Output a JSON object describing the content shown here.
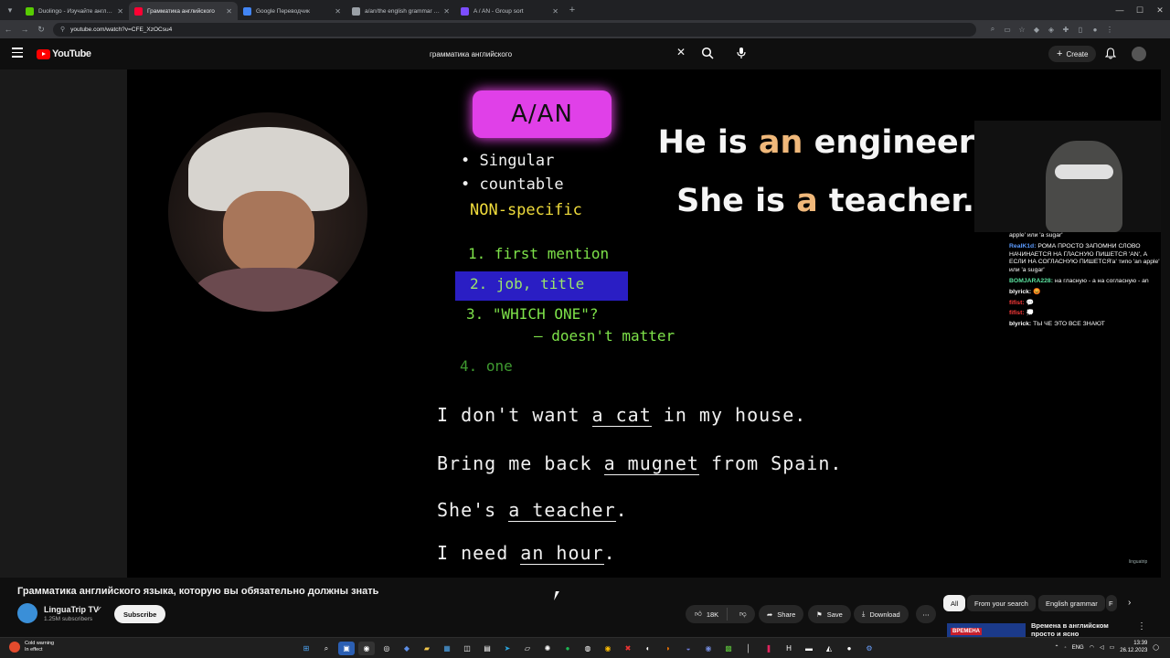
{
  "browser": {
    "tabs": [
      {
        "title": "Duolingo - Изучайте английск",
        "favicon_color": "#58cc02",
        "active": false
      },
      {
        "title": "Грамматика английского",
        "favicon_color": "#ff0033",
        "active": true
      },
      {
        "title": "Google Переводчик",
        "favicon_color": "#4285f4",
        "active": false
      },
      {
        "title": "a/an/the english grammar gam",
        "favicon_color": "#9aa0a6",
        "active": false
      },
      {
        "title": "A / AN - Group sort",
        "favicon_color": "#7c4dff",
        "active": false
      }
    ],
    "url": "youtube.com/watch?v=CFE_XzOCsu4"
  },
  "masthead": {
    "logo_text": "YouTube",
    "search_value": "грамматика английского",
    "create_label": "Create"
  },
  "slide": {
    "title": "A/AN",
    "bullets": [
      "Singular",
      "countable"
    ],
    "nonspecific": "NON-specific",
    "rules": [
      {
        "text": "1. first mention"
      },
      {
        "text": "2. job, title"
      },
      {
        "text": "3. \"WHICH ONE\"?"
      },
      {
        "text": "— doesn't matter"
      },
      {
        "text": "4. one"
      }
    ],
    "sentences": [
      {
        "pre": "I don't want ",
        "art": "a cat",
        "post": " in my house."
      },
      {
        "pre": "Bring me back ",
        "art": "a mugnet",
        "post": " from Spain."
      },
      {
        "pre": "She's ",
        "art": "a teacher",
        "post": "."
      },
      {
        "pre": "I need ",
        "art": "an hour",
        "post": "."
      }
    ],
    "big_lines": [
      {
        "pre": "He is ",
        "art": "an",
        "post": " engineer"
      },
      {
        "pre": "She is ",
        "art": "a",
        "post": " teacher."
      }
    ],
    "watermark": "linguatrip"
  },
  "chat": [
    {
      "user": "",
      "user_color": "#ffffff",
      "text": "apple' или 'a sugar'"
    },
    {
      "user": "RealK1d:",
      "user_color": "#5b9bff",
      "text": "РОМА ПРОСТО ЗАПОМНИ СЛОВО НАЧИНАЕТСЯ НА ГЛАСНУЮ ПИШЕТСЯ 'AN', А ЕСЛИ НА СОГЛАСНУЮ ПИШЕТСЯ'a' типо 'an apple' или 'a sugar'"
    },
    {
      "user": "BOMJARA228:",
      "user_color": "#5be3a0",
      "text": "на гласную - а на согласную - an"
    },
    {
      "user": "blyrick:",
      "user_color": "#ffffff",
      "text": "😡"
    },
    {
      "user": "fifist:",
      "user_color": "#ff3b3b",
      "text": "💬"
    },
    {
      "user": "fifist:",
      "user_color": "#ff3b3b",
      "text": "💭"
    },
    {
      "user": "blyrick:",
      "user_color": "#ffffff",
      "text": "ТЫ ЧЕ ЭТО ВСЕ ЗНАЮТ"
    }
  ],
  "video": {
    "title": "Грамматика английского языка, которую вы обязательно должны знать",
    "channel": "LinguaTrip TV",
    "subscribers": "1.25M subscribers",
    "subscribe_label": "Subscribe",
    "likes": "18K",
    "share_label": "Share",
    "save_label": "Save",
    "download_label": "Download"
  },
  "chips": [
    "All",
    "From your search",
    "English grammar",
    "F"
  ],
  "recommendation": {
    "thumb_label": "ВРЕМЕНА",
    "title": "Времена в английском просто и ясно"
  },
  "taskbar": {
    "weather_title": "Cold warning",
    "weather_sub": "In effect",
    "lang": "ENG",
    "time": "13:39",
    "date": "26.12.2023"
  }
}
